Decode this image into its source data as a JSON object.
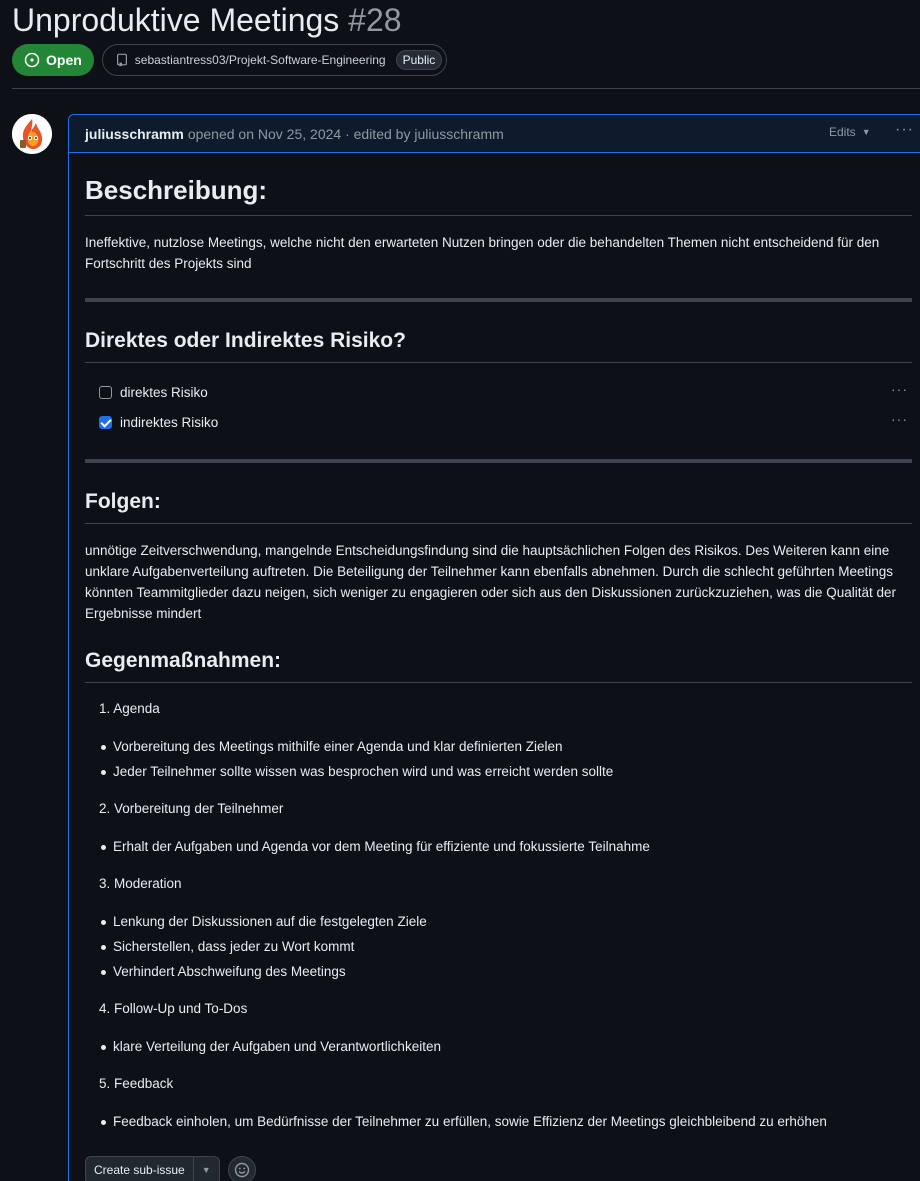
{
  "issue": {
    "title": "Unproduktive Meetings",
    "number": "#28",
    "state_label": "Open",
    "repo": "sebastiantress03/Projekt-Software-Engineering",
    "visibility": "Public"
  },
  "comment": {
    "author": "juliusschramm",
    "action": "opened on Nov 25, 2024 · edited by juliusschramm",
    "edits_label": "Edits"
  },
  "body": {
    "h_beschreibung": "Beschreibung:",
    "beschreibung_text": "Ineffektive, nutzlose Meetings, welche nicht den erwarteten Nutzen bringen oder die behandelten Themen nicht entscheidend für den Fortschritt des Projekts sind",
    "h_risiko": "Direktes oder Indirektes Risiko?",
    "tasks": [
      {
        "label": "direktes Risiko",
        "checked": false
      },
      {
        "label": "indirektes Risiko",
        "checked": true
      }
    ],
    "h_folgen": "Folgen:",
    "folgen_text": "unnötige Zeitverschwendung, mangelnde Entscheidungsfindung sind die hauptsächlichen Folgen des Risikos. Des Weiteren kann eine unklare Aufgabenverteilung auftreten. Die Beteiligung der Teilnehmer kann ebenfalls abnehmen. Durch die schlecht geführten Meetings könnten Teammitglieder dazu neigen, sich weniger zu engagieren oder sich aus den Diskussionen zurückzuziehen, was die Qualität der Ergebnisse mindert",
    "h_gegen": "Gegenmaßnahmen:",
    "measures": [
      {
        "num": "1. Agenda",
        "bullets": [
          "Vorbereitung des Meetings mithilfe einer Agenda und klar definierten Zielen",
          "Jeder Teilnehmer sollte wissen was besprochen wird und was erreicht werden sollte"
        ]
      },
      {
        "num": "2. Vorbereitung der Teilnehmer",
        "bullets": [
          "Erhalt der Aufgaben und Agenda vor dem Meeting für effiziente und fokussierte Teilnahme"
        ]
      },
      {
        "num": "3. Moderation",
        "bullets": [
          "Lenkung der Diskussionen auf die festgelegten Ziele",
          "Sicherstellen, dass jeder zu Wort kommt",
          "Verhindert Abschweifung des Meetings"
        ]
      },
      {
        "num": "4. Follow-Up und To-Dos",
        "bullets": [
          "klare Verteilung der Aufgaben und Verantwortlichkeiten"
        ]
      },
      {
        "num": "5. Feedback",
        "bullets": [
          "Feedback einholen, um Bedürfnisse der Teilnehmer zu erfüllen, sowie Effizienz der Meetings gleichbleibend zu erhöhen"
        ]
      }
    ]
  },
  "actions": {
    "create_sub_issue": "Create sub-issue"
  },
  "colors": {
    "accent": "#1f6feb",
    "open_green": "#238636",
    "background": "#0d1117"
  }
}
